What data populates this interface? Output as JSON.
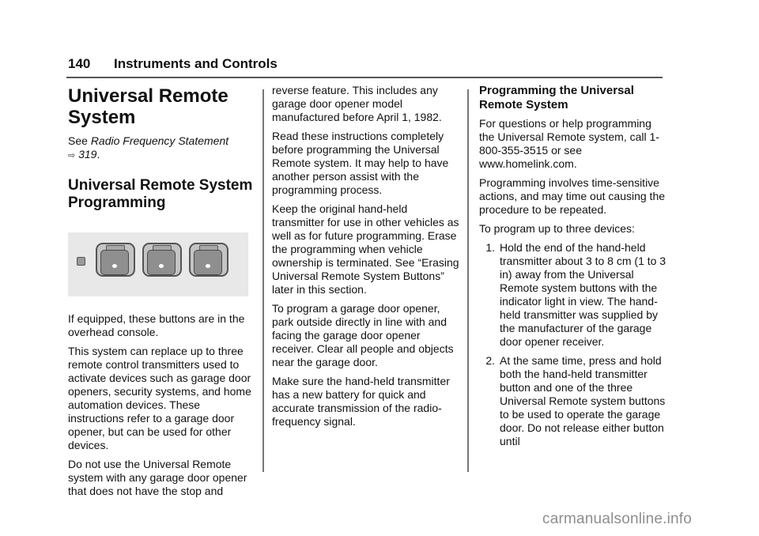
{
  "header": {
    "page_number": "140",
    "section_title": "Instruments and Controls"
  },
  "column1": {
    "title": "Universal Remote System",
    "see_prefix": "See ",
    "see_ref": "Radio Frequency Statement",
    "ref_icon": "page-reference-arrow-icon",
    "ref_page": "319",
    "ref_suffix": ".",
    "subtitle": "Universal Remote System Programming",
    "figure_alt": "overhead console universal remote buttons",
    "paragraphs": [
      "If equipped, these buttons are in the overhead console.",
      "This system can replace up to three remote control transmitters used to activate devices such as garage door openers, security systems, and home automation devices. These instructions refer to a garage door opener, but can be used for other devices.",
      "Do not use the Universal Remote system with any garage door opener that does not have the stop and"
    ]
  },
  "column2": {
    "paragraphs": [
      "reverse feature. This includes any garage door opener model manufactured before April 1, 1982.",
      "Read these instructions completely before programming the Universal Remote system. It may help to have another person assist with the programming process.",
      "Keep the original hand-held transmitter for use in other vehicles as well as for future programming. Erase the programming when vehicle ownership is terminated. See “Erasing Universal Remote System Buttons” later in this section.",
      "To program a garage door opener, park outside directly in line with and facing the garage door opener receiver. Clear all people and objects near the garage door.",
      "Make sure the hand-held transmitter has a new battery for quick and accurate transmission of the radio-frequency signal."
    ]
  },
  "column3": {
    "heading": "Programming the Universal Remote System",
    "paragraphs": [
      "For questions or help programming the Universal Remote system, call 1-800-355-3515 or see www.homelink.com.",
      "Programming involves time-sensitive actions, and may time out causing the procedure to be repeated.",
      "To program up to three devices:"
    ],
    "steps": [
      {
        "num": "1.",
        "text": "Hold the end of the hand-held transmitter about 3 to 8 cm (1 to 3 in) away from the Universal Remote system buttons with the indicator light in view. The hand-held transmitter was supplied by the manufacturer of the garage door opener receiver."
      },
      {
        "num": "2.",
        "text": "At the same time, press and hold both the hand-held transmitter button and one of the three Universal Remote system buttons to be used to operate the garage door. Do not release either button until"
      }
    ]
  },
  "watermark": "carmanualsonline.info"
}
